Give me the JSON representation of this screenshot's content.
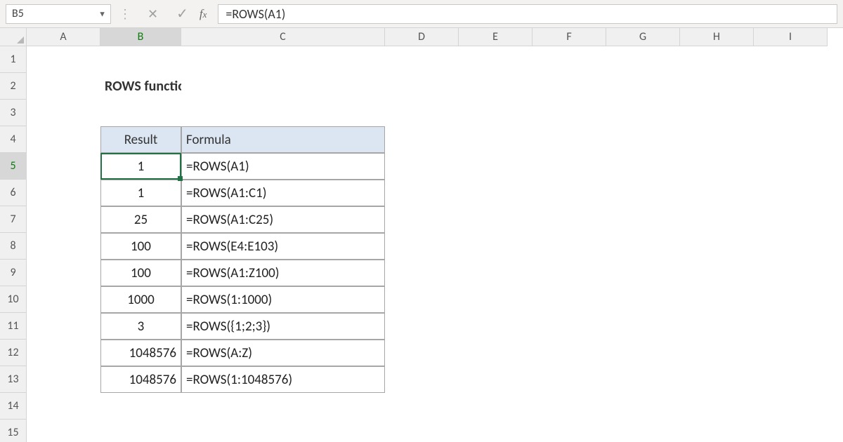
{
  "namebox": {
    "value": "B5"
  },
  "formula_bar": {
    "value": "=ROWS(A1)"
  },
  "columns": [
    "A",
    "B",
    "C",
    "D",
    "E",
    "F",
    "G",
    "H",
    "I"
  ],
  "row_numbers": [
    1,
    2,
    3,
    4,
    5,
    6,
    7,
    8,
    9,
    10,
    11,
    12,
    13,
    14,
    15
  ],
  "active": {
    "col": "B",
    "row": 5
  },
  "title_cell": {
    "text": "ROWS function"
  },
  "table": {
    "headers": {
      "result": "Result",
      "formula": "Formula"
    },
    "rows": [
      {
        "result": "1",
        "formula": "=ROWS(A1)"
      },
      {
        "result": "1",
        "formula": "=ROWS(A1:C1)"
      },
      {
        "result": "25",
        "formula": "=ROWS(A1:C25)"
      },
      {
        "result": "100",
        "formula": "=ROWS(E4:E103)"
      },
      {
        "result": "100",
        "formula": "=ROWS(A1:Z100)"
      },
      {
        "result": "1000",
        "formula": "=ROWS(1:1000)"
      },
      {
        "result": "3",
        "formula": "=ROWS({1;2;3})"
      },
      {
        "result": "1048576",
        "formula": "=ROWS(A:Z)"
      },
      {
        "result": "1048576",
        "formula": "=ROWS(1:1048576)"
      }
    ]
  },
  "chart_data": {
    "type": "table",
    "title": "ROWS function",
    "columns": [
      "Result",
      "Formula"
    ],
    "rows": [
      [
        "1",
        "=ROWS(A1)"
      ],
      [
        "1",
        "=ROWS(A1:C1)"
      ],
      [
        "25",
        "=ROWS(A1:C25)"
      ],
      [
        "100",
        "=ROWS(E4:E103)"
      ],
      [
        "100",
        "=ROWS(A1:Z100)"
      ],
      [
        "1000",
        "=ROWS(1:1000)"
      ],
      [
        "3",
        "=ROWS({1;2;3})"
      ],
      [
        "1048576",
        "=ROWS(A:Z)"
      ],
      [
        "1048576",
        "=ROWS(1:1048576)"
      ]
    ]
  }
}
